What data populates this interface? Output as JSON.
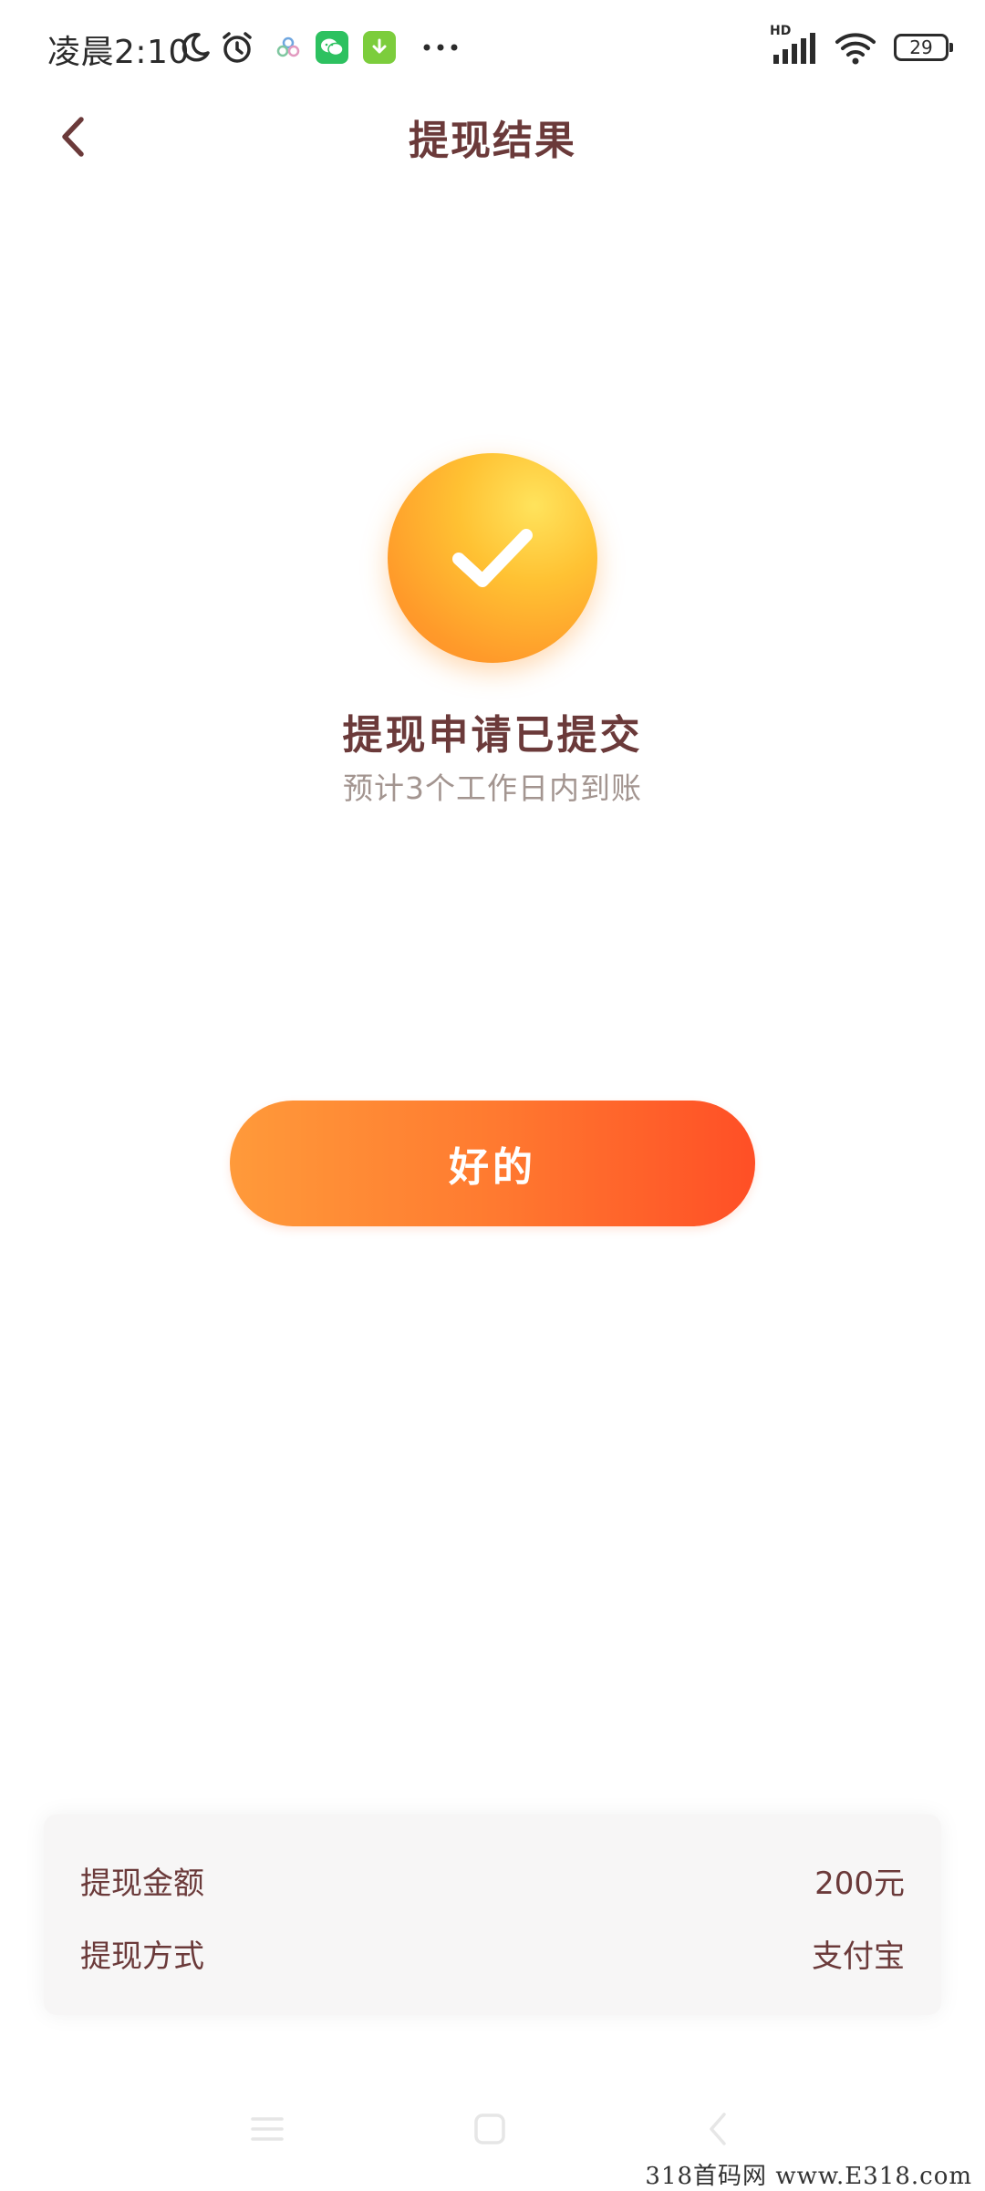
{
  "status_bar": {
    "time": "凌晨2:10",
    "network_label": "HD",
    "battery_level": "29",
    "icons": [
      "moon-icon",
      "alarm-icon",
      "app-icon",
      "wechat-icon",
      "download-icon",
      "more-icon",
      "signal-icon",
      "wifi-icon",
      "battery-icon"
    ]
  },
  "header": {
    "title": "提现结果",
    "back_icon": "chevron-left-icon"
  },
  "result": {
    "icon": "check-icon",
    "title": "提现申请已提交",
    "subtitle": "预计3个工作日内到账"
  },
  "actions": {
    "ok_label": "好的"
  },
  "details": {
    "rows": [
      {
        "label": "提现金额",
        "value": "200元"
      },
      {
        "label": "提现方式",
        "value": "支付宝"
      }
    ]
  },
  "nav_bar": {
    "icons": [
      "menu-icon",
      "home-icon",
      "back-icon"
    ]
  },
  "watermark": "318首码网 www.E318.com",
  "colors": {
    "title_text": "#6b3a3a",
    "subtitle_text": "#a39590",
    "button_gradient_start": "#ff9a3a",
    "button_gradient_end": "#ff4f26",
    "success_icon_light": "#ffe35c",
    "success_icon_dark": "#ff8a28",
    "card_background": "#f7f6f6"
  }
}
